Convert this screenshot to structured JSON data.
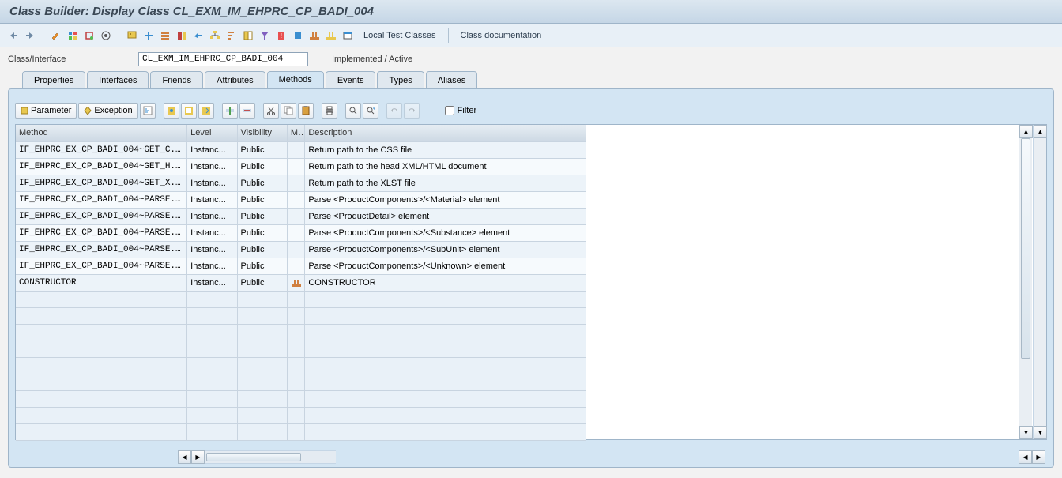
{
  "title": "Class Builder: Display Class CL_EXM_IM_EHPRC_CP_BADI_004",
  "toolbar": {
    "local_test": "Local Test Classes",
    "class_doc": "Class documentation"
  },
  "form": {
    "class_label": "Class/Interface",
    "class_value": "CL_EXM_IM_EHPRC_CP_BADI_004",
    "status": "Implemented / Active"
  },
  "tabs": [
    "Properties",
    "Interfaces",
    "Friends",
    "Attributes",
    "Methods",
    "Events",
    "Types",
    "Aliases"
  ],
  "active_tab": 4,
  "panel_buttons": {
    "parameter": "Parameter",
    "exception": "Exception"
  },
  "filter_label": "Filter",
  "columns": {
    "method": "Method",
    "level": "Level",
    "visibility": "Visibility",
    "m": "M...",
    "description": "Description"
  },
  "rows": [
    {
      "method": "IF_EHPRC_EX_CP_BADI_004~GET_C...",
      "level": "Instanc...",
      "visibility": "Public",
      "m": "",
      "description": "Return path to the CSS file"
    },
    {
      "method": "IF_EHPRC_EX_CP_BADI_004~GET_H...",
      "level": "Instanc...",
      "visibility": "Public",
      "m": "",
      "description": "Return path to the head XML/HTML document"
    },
    {
      "method": "IF_EHPRC_EX_CP_BADI_004~GET_X...",
      "level": "Instanc...",
      "visibility": "Public",
      "m": "",
      "description": "Return path to the XLST file"
    },
    {
      "method": "IF_EHPRC_EX_CP_BADI_004~PARSE...",
      "level": "Instanc...",
      "visibility": "Public",
      "m": "",
      "description": "Parse <ProductComponents>/<Material> element"
    },
    {
      "method": "IF_EHPRC_EX_CP_BADI_004~PARSE...",
      "level": "Instanc...",
      "visibility": "Public",
      "m": "",
      "description": "Parse <ProductDetail> element"
    },
    {
      "method": "IF_EHPRC_EX_CP_BADI_004~PARSE...",
      "level": "Instanc...",
      "visibility": "Public",
      "m": "",
      "description": "Parse <ProductComponents>/<Substance> element"
    },
    {
      "method": "IF_EHPRC_EX_CP_BADI_004~PARSE...",
      "level": "Instanc...",
      "visibility": "Public",
      "m": "",
      "description": "Parse <ProductComponents>/<SubUnit> element"
    },
    {
      "method": "IF_EHPRC_EX_CP_BADI_004~PARSE...",
      "level": "Instanc...",
      "visibility": "Public",
      "m": "",
      "description": "Parse <ProductComponents>/<Unknown> element"
    },
    {
      "method": "CONSTRUCTOR",
      "level": "Instanc...",
      "visibility": "Public",
      "m": "icon",
      "description": "CONSTRUCTOR"
    }
  ],
  "empty_rows": 9
}
